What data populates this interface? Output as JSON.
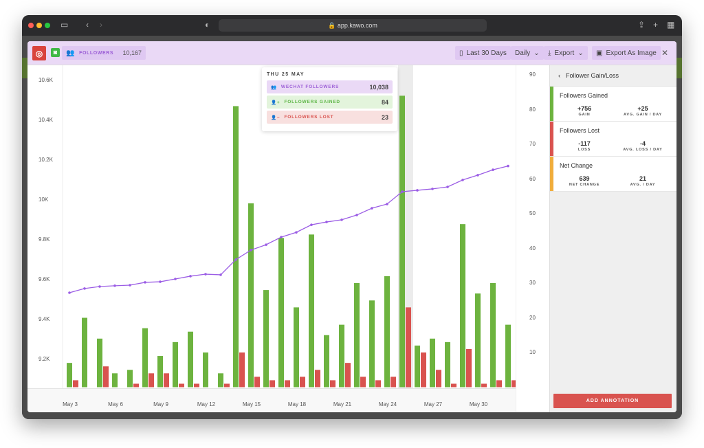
{
  "browser": {
    "url": "app.kawo.com"
  },
  "header": {
    "followers_label": "FOLLOWERS",
    "followers_count": "10,167",
    "date_range": "Last 30 Days",
    "interval": "Daily",
    "export": "Export",
    "export_image": "Export As Image",
    "close": "✕"
  },
  "tooltip": {
    "date": "THU 25 MAY",
    "rows": [
      {
        "label": "WECHAT FOLLOWERS",
        "value": "10,038",
        "color": "#9c5fd6",
        "bg": "#ead9f6"
      },
      {
        "label": "FOLLOWERS GAINED",
        "value": "84",
        "color": "#5cb545",
        "bg": "#e3f4dc"
      },
      {
        "label": "FOLLOWERS LOST",
        "value": "23",
        "color": "#d9534f",
        "bg": "#f8e0df"
      }
    ]
  },
  "side": {
    "title": "Follower Gain/Loss",
    "cards": [
      {
        "title": "Followers Gained",
        "color": "#6db33f",
        "a_val": "+756",
        "a_lbl": "GAIN",
        "b_val": "+25",
        "b_lbl": "AVG. GAIN / DAY"
      },
      {
        "title": "Followers Lost",
        "color": "#d9534f",
        "a_val": "-117",
        "a_lbl": "LOSS",
        "b_val": "-4",
        "b_lbl": "AVG. LOSS / DAY"
      },
      {
        "title": "Net Change",
        "color": "#f0ad3c",
        "a_val": "639",
        "a_lbl": "NET CHANGE",
        "b_val": "21",
        "b_lbl": "AVG. / DAY"
      }
    ],
    "add_annotation": "ADD ANNOTATION"
  },
  "chart_data": {
    "type": "bar+line",
    "dates": [
      "May 3",
      "May 4",
      "May 5",
      "May 6",
      "May 7",
      "May 8",
      "May 9",
      "May 10",
      "May 11",
      "May 12",
      "May 13",
      "May 14",
      "May 15",
      "May 16",
      "May 17",
      "May 18",
      "May 19",
      "May 20",
      "May 21",
      "May 22",
      "May 23",
      "May 24",
      "May 25",
      "May 26",
      "May 27",
      "May 28",
      "May 29",
      "May 30",
      "May 31",
      "Jun 1"
    ],
    "x_tick_labels": [
      "May 3",
      "May 6",
      "May 9",
      "May 12",
      "May 15",
      "May 18",
      "May 21",
      "May 24",
      "May 27",
      "May 30"
    ],
    "left_axis": {
      "ticks": [
        "9.2K",
        "9.4K",
        "9.6K",
        "9.8K",
        "10K",
        "10.2K",
        "10.4K",
        "10.6K"
      ],
      "range": [
        9100,
        10650
      ]
    },
    "right_axis": {
      "ticks": [
        "10",
        "20",
        "30",
        "40",
        "50",
        "60",
        "70",
        "80",
        "90"
      ],
      "range": [
        0,
        92
      ]
    },
    "highlighted_date": "May 25",
    "series": [
      {
        "name": "WeChat Followers",
        "type": "line",
        "axis": "left",
        "color": "#9b5de5",
        "values": [
          9531,
          9552,
          9562,
          9566,
          9569,
          9583,
          9586,
          9600,
          9614,
          9624,
          9621,
          9697,
          9745,
          9772,
          9810,
          9834,
          9872,
          9886,
          9897,
          9921,
          9955,
          9976,
          10038,
          10045,
          10052,
          10062,
          10097,
          10121,
          10148,
          10167
        ]
      },
      {
        "name": "Followers Gained",
        "type": "bar",
        "axis": "right",
        "color": "#6db33f",
        "values": [
          7,
          20,
          14,
          4,
          5,
          17,
          9,
          13,
          16,
          10,
          4,
          81,
          53,
          28,
          43,
          23,
          44,
          15,
          18,
          30,
          25,
          32,
          84,
          12,
          14,
          13,
          47,
          27,
          30,
          18
        ]
      },
      {
        "name": "Followers Lost",
        "type": "bar",
        "axis": "right",
        "color": "#d9534f",
        "values": [
          2,
          0,
          6,
          0,
          1,
          4,
          4,
          1,
          1,
          0,
          1,
          10,
          3,
          2,
          2,
          3,
          5,
          2,
          7,
          3,
          2,
          3,
          23,
          10,
          5,
          1,
          11,
          1,
          2,
          2
        ]
      }
    ]
  }
}
